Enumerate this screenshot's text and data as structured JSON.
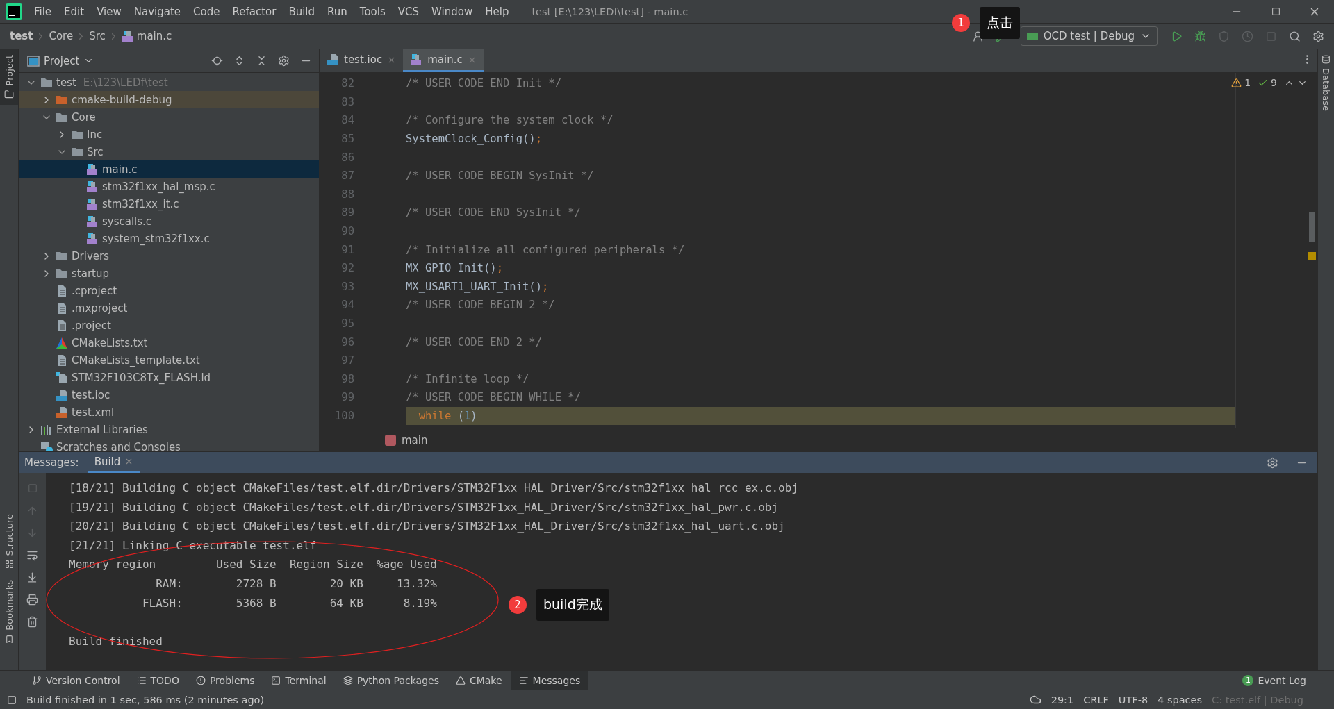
{
  "menu_bar": {
    "items": [
      "File",
      "Edit",
      "View",
      "Navigate",
      "Code",
      "Refactor",
      "Build",
      "Run",
      "Tools",
      "VCS",
      "Window",
      "Help"
    ],
    "title": "test [E:\\123\\LEDf\\test] - main.c"
  },
  "nav_bar": {
    "breadcrumbs": [
      "test",
      "Core",
      "Src",
      "main.c"
    ],
    "run_configuration": "OCD test | Debug"
  },
  "side_strips": {
    "left": [
      "Project",
      "Structure",
      "Bookmarks"
    ],
    "right": [
      "Database"
    ]
  },
  "project_panel": {
    "title": "Project",
    "tree": [
      {
        "name": "test",
        "hint": "E:\\123\\LEDf\\test",
        "kind": "folder",
        "expanded": true,
        "selected": false,
        "children": [
          {
            "name": "cmake-build-debug",
            "kind": "build_folder",
            "expanded": false,
            "selected": false
          },
          {
            "name": "Core",
            "kind": "folder",
            "expanded": true,
            "selected": false,
            "children": [
              {
                "name": "Inc",
                "kind": "folder",
                "expanded": false,
                "selected": false
              },
              {
                "name": "Src",
                "kind": "folder",
                "expanded": true,
                "selected": false,
                "children": [
                  {
                    "name": "main.c",
                    "kind": "c_file",
                    "selected": true
                  },
                  {
                    "name": "stm32f1xx_hal_msp.c",
                    "kind": "c_file",
                    "selected": false
                  },
                  {
                    "name": "stm32f1xx_it.c",
                    "kind": "c_file",
                    "selected": false
                  },
                  {
                    "name": "syscalls.c",
                    "kind": "c_file",
                    "selected": false
                  },
                  {
                    "name": "system_stm32f1xx.c",
                    "kind": "c_file",
                    "selected": false
                  }
                ]
              }
            ]
          },
          {
            "name": "Drivers",
            "kind": "folder",
            "expanded": false,
            "selected": false
          },
          {
            "name": "startup",
            "kind": "folder",
            "expanded": false,
            "selected": false
          },
          {
            "name": ".cproject",
            "kind": "text_file",
            "selected": false
          },
          {
            "name": ".mxproject",
            "kind": "text_file",
            "selected": false
          },
          {
            "name": ".project",
            "kind": "text_file",
            "selected": false
          },
          {
            "name": "CMakeLists.txt",
            "kind": "cmake_file",
            "selected": false
          },
          {
            "name": "CMakeLists_template.txt",
            "kind": "text_file",
            "selected": false
          },
          {
            "name": "STM32F103C8Tx_FLASH.ld",
            "kind": "ld_file",
            "selected": false
          },
          {
            "name": "test.ioc",
            "kind": "ioc_file",
            "selected": false
          },
          {
            "name": "test.xml",
            "kind": "xml_file",
            "selected": false
          }
        ]
      },
      {
        "name": "External Libraries",
        "kind": "libraries",
        "expanded": false,
        "selected": false
      },
      {
        "name": "Scratches and Consoles",
        "kind": "scratches",
        "selected": false
      }
    ]
  },
  "editor": {
    "tabs": [
      {
        "label": "test.ioc",
        "kind": "ioc_file",
        "selected": false
      },
      {
        "label": "main.c",
        "kind": "c_file",
        "selected": true
      }
    ],
    "inspections": {
      "warnings": "1",
      "weak_warnings": "9"
    },
    "lines": [
      {
        "number": "82",
        "current": false,
        "segments": [
          {
            "kind": "comment",
            "text": "/* USER CODE END Init */"
          }
        ]
      },
      {
        "number": "83",
        "current": false
      },
      {
        "number": "84",
        "current": false,
        "segments": [
          {
            "kind": "comment",
            "text": "/* Configure the system clock */"
          }
        ]
      },
      {
        "number": "85",
        "current": false,
        "segments": [
          {
            "kind": "plain",
            "text": "SystemClock_Config()"
          },
          {
            "kind": "punct",
            "text": ";"
          }
        ]
      },
      {
        "number": "86",
        "current": false
      },
      {
        "number": "87",
        "current": false,
        "segments": [
          {
            "kind": "comment",
            "text": "/* USER CODE BEGIN SysInit */"
          }
        ]
      },
      {
        "number": "88",
        "current": false
      },
      {
        "number": "89",
        "current": false,
        "segments": [
          {
            "kind": "comment",
            "text": "/* USER CODE END SysInit */"
          }
        ]
      },
      {
        "number": "90",
        "current": false
      },
      {
        "number": "91",
        "current": false,
        "segments": [
          {
            "kind": "comment",
            "text": "/* Initialize all configured peripherals */"
          }
        ]
      },
      {
        "number": "92",
        "current": false,
        "segments": [
          {
            "kind": "plain",
            "text": "MX_GPIO_Init()"
          },
          {
            "kind": "punct",
            "text": ";"
          }
        ]
      },
      {
        "number": "93",
        "current": false,
        "segments": [
          {
            "kind": "plain",
            "text": "MX_USART1_UART_Init()"
          },
          {
            "kind": "punct",
            "text": ";"
          }
        ]
      },
      {
        "number": "94",
        "current": false,
        "segments": [
          {
            "kind": "comment",
            "text": "/* USER CODE BEGIN 2 */"
          }
        ]
      },
      {
        "number": "95",
        "current": false
      },
      {
        "number": "96",
        "current": false,
        "segments": [
          {
            "kind": "comment",
            "text": "/* USER CODE END 2 */"
          }
        ]
      },
      {
        "number": "97",
        "current": false
      },
      {
        "number": "98",
        "current": false,
        "segments": [
          {
            "kind": "comment",
            "text": "/* Infinite loop */"
          }
        ]
      },
      {
        "number": "99",
        "current": false,
        "segments": [
          {
            "kind": "comment",
            "text": "/* USER CODE BEGIN WHILE */"
          }
        ]
      },
      {
        "number": "100",
        "current": true,
        "segments": [
          {
            "kind": "keyword",
            "text": "  while "
          },
          {
            "kind": "plain",
            "text": "("
          },
          {
            "kind": "number",
            "text": "1"
          },
          {
            "kind": "plain",
            "text": ")"
          }
        ]
      }
    ],
    "breadcrumb": "main"
  },
  "messages_panel": {
    "label": "Messages:",
    "tabs": [
      {
        "label": "Build",
        "selected": true
      }
    ],
    "lines": [
      {
        "text": "[18/21] Building C object CMakeFiles/test.elf.dir/Drivers/STM32F1xx_HAL_Driver/Src/stm32f1xx_hal_rcc_ex.c.obj",
        "blank_line_before": false
      },
      {
        "text": "[19/21] Building C object CMakeFiles/test.elf.dir/Drivers/STM32F1xx_HAL_Driver/Src/stm32f1xx_hal_pwr.c.obj",
        "blank_line_before": false
      },
      {
        "text": "[20/21] Building C object CMakeFiles/test.elf.dir/Drivers/STM32F1xx_HAL_Driver/Src/stm32f1xx_hal_uart.c.obj",
        "blank_line_before": false
      },
      {
        "text": "[21/21] Linking C executable test.elf",
        "blank_line_before": false
      },
      {
        "text": "Memory region         Used Size  Region Size  %age Used",
        "blank_line_before": false
      },
      {
        "text": "             RAM:        2728 B        20 KB     13.32%",
        "blank_line_before": false
      },
      {
        "text": "           FLASH:        5368 B        64 KB      8.19%",
        "blank_line_before": false
      },
      {
        "text": "Build finished",
        "blank_line_before": true
      }
    ]
  },
  "tool_tabs": [
    {
      "label": "Version Control",
      "kind": "vcs",
      "selected": false
    },
    {
      "label": "TODO",
      "kind": "todo",
      "selected": false
    },
    {
      "label": "Problems",
      "kind": "problems",
      "selected": false
    },
    {
      "label": "Terminal",
      "kind": "terminal",
      "selected": false
    },
    {
      "label": "Python Packages",
      "kind": "packages",
      "selected": false
    },
    {
      "label": "CMake",
      "kind": "cmake",
      "selected": false
    },
    {
      "label": "Messages",
      "kind": "messages",
      "selected": true
    }
  ],
  "event_log": {
    "label": "Event Log",
    "count": "1"
  },
  "status_bar": {
    "message": "Build finished in 1 sec, 586 ms (2 minutes ago)",
    "items": [
      "29:1",
      "CRLF",
      "UTF-8",
      "4 spaces",
      "C: test.elf | Debug"
    ]
  },
  "annotations": [
    {
      "number": "1",
      "text": "点击"
    },
    {
      "number": "2",
      "text": "build完成"
    }
  ]
}
